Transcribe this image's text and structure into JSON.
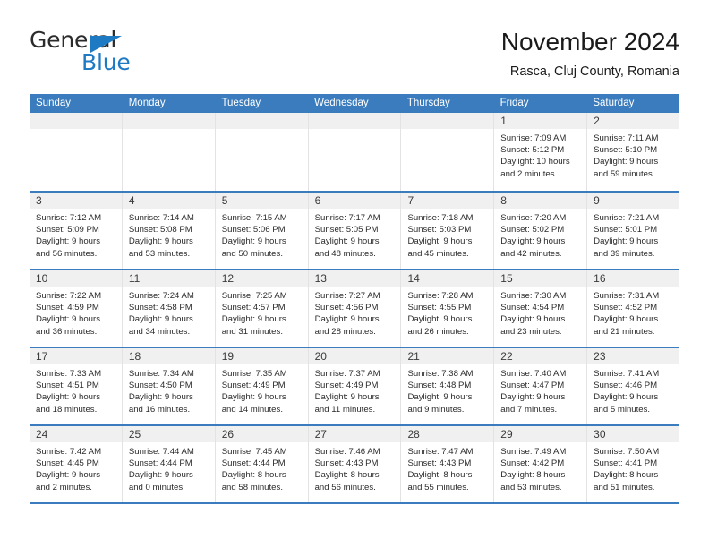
{
  "brand": {
    "name_part1": "General",
    "name_part2": "Blue"
  },
  "header": {
    "title": "November 2024",
    "subtitle": "Rasca, Cluj County, Romania"
  },
  "colors": {
    "header_blue": "#3a7cbd",
    "logo_blue": "#1f7ac4",
    "daynum_band": "#f0f0f0",
    "cell_border": "#e3e3e3"
  },
  "weekdays": [
    "Sunday",
    "Monday",
    "Tuesday",
    "Wednesday",
    "Thursday",
    "Friday",
    "Saturday"
  ],
  "labels": {
    "sunrise_prefix": "Sunrise:",
    "sunset_prefix": "Sunset:",
    "daylight_prefix": "Daylight:"
  },
  "weeks": [
    [
      {
        "day": "",
        "empty": true
      },
      {
        "day": "",
        "empty": true
      },
      {
        "day": "",
        "empty": true
      },
      {
        "day": "",
        "empty": true
      },
      {
        "day": "",
        "empty": true
      },
      {
        "day": "1",
        "sunrise": "Sunrise: 7:09 AM",
        "sunset": "Sunset: 5:12 PM",
        "daylight_line1": "Daylight: 10 hours",
        "daylight_line2": "and 2 minutes."
      },
      {
        "day": "2",
        "sunrise": "Sunrise: 7:11 AM",
        "sunset": "Sunset: 5:10 PM",
        "daylight_line1": "Daylight: 9 hours",
        "daylight_line2": "and 59 minutes."
      }
    ],
    [
      {
        "day": "3",
        "sunrise": "Sunrise: 7:12 AM",
        "sunset": "Sunset: 5:09 PM",
        "daylight_line1": "Daylight: 9 hours",
        "daylight_line2": "and 56 minutes."
      },
      {
        "day": "4",
        "sunrise": "Sunrise: 7:14 AM",
        "sunset": "Sunset: 5:08 PM",
        "daylight_line1": "Daylight: 9 hours",
        "daylight_line2": "and 53 minutes."
      },
      {
        "day": "5",
        "sunrise": "Sunrise: 7:15 AM",
        "sunset": "Sunset: 5:06 PM",
        "daylight_line1": "Daylight: 9 hours",
        "daylight_line2": "and 50 minutes."
      },
      {
        "day": "6",
        "sunrise": "Sunrise: 7:17 AM",
        "sunset": "Sunset: 5:05 PM",
        "daylight_line1": "Daylight: 9 hours",
        "daylight_line2": "and 48 minutes."
      },
      {
        "day": "7",
        "sunrise": "Sunrise: 7:18 AM",
        "sunset": "Sunset: 5:03 PM",
        "daylight_line1": "Daylight: 9 hours",
        "daylight_line2": "and 45 minutes."
      },
      {
        "day": "8",
        "sunrise": "Sunrise: 7:20 AM",
        "sunset": "Sunset: 5:02 PM",
        "daylight_line1": "Daylight: 9 hours",
        "daylight_line2": "and 42 minutes."
      },
      {
        "day": "9",
        "sunrise": "Sunrise: 7:21 AM",
        "sunset": "Sunset: 5:01 PM",
        "daylight_line1": "Daylight: 9 hours",
        "daylight_line2": "and 39 minutes."
      }
    ],
    [
      {
        "day": "10",
        "sunrise": "Sunrise: 7:22 AM",
        "sunset": "Sunset: 4:59 PM",
        "daylight_line1": "Daylight: 9 hours",
        "daylight_line2": "and 36 minutes."
      },
      {
        "day": "11",
        "sunrise": "Sunrise: 7:24 AM",
        "sunset": "Sunset: 4:58 PM",
        "daylight_line1": "Daylight: 9 hours",
        "daylight_line2": "and 34 minutes."
      },
      {
        "day": "12",
        "sunrise": "Sunrise: 7:25 AM",
        "sunset": "Sunset: 4:57 PM",
        "daylight_line1": "Daylight: 9 hours",
        "daylight_line2": "and 31 minutes."
      },
      {
        "day": "13",
        "sunrise": "Sunrise: 7:27 AM",
        "sunset": "Sunset: 4:56 PM",
        "daylight_line1": "Daylight: 9 hours",
        "daylight_line2": "and 28 minutes."
      },
      {
        "day": "14",
        "sunrise": "Sunrise: 7:28 AM",
        "sunset": "Sunset: 4:55 PM",
        "daylight_line1": "Daylight: 9 hours",
        "daylight_line2": "and 26 minutes."
      },
      {
        "day": "15",
        "sunrise": "Sunrise: 7:30 AM",
        "sunset": "Sunset: 4:54 PM",
        "daylight_line1": "Daylight: 9 hours",
        "daylight_line2": "and 23 minutes."
      },
      {
        "day": "16",
        "sunrise": "Sunrise: 7:31 AM",
        "sunset": "Sunset: 4:52 PM",
        "daylight_line1": "Daylight: 9 hours",
        "daylight_line2": "and 21 minutes."
      }
    ],
    [
      {
        "day": "17",
        "sunrise": "Sunrise: 7:33 AM",
        "sunset": "Sunset: 4:51 PM",
        "daylight_line1": "Daylight: 9 hours",
        "daylight_line2": "and 18 minutes."
      },
      {
        "day": "18",
        "sunrise": "Sunrise: 7:34 AM",
        "sunset": "Sunset: 4:50 PM",
        "daylight_line1": "Daylight: 9 hours",
        "daylight_line2": "and 16 minutes."
      },
      {
        "day": "19",
        "sunrise": "Sunrise: 7:35 AM",
        "sunset": "Sunset: 4:49 PM",
        "daylight_line1": "Daylight: 9 hours",
        "daylight_line2": "and 14 minutes."
      },
      {
        "day": "20",
        "sunrise": "Sunrise: 7:37 AM",
        "sunset": "Sunset: 4:49 PM",
        "daylight_line1": "Daylight: 9 hours",
        "daylight_line2": "and 11 minutes."
      },
      {
        "day": "21",
        "sunrise": "Sunrise: 7:38 AM",
        "sunset": "Sunset: 4:48 PM",
        "daylight_line1": "Daylight: 9 hours",
        "daylight_line2": "and 9 minutes."
      },
      {
        "day": "22",
        "sunrise": "Sunrise: 7:40 AM",
        "sunset": "Sunset: 4:47 PM",
        "daylight_line1": "Daylight: 9 hours",
        "daylight_line2": "and 7 minutes."
      },
      {
        "day": "23",
        "sunrise": "Sunrise: 7:41 AM",
        "sunset": "Sunset: 4:46 PM",
        "daylight_line1": "Daylight: 9 hours",
        "daylight_line2": "and 5 minutes."
      }
    ],
    [
      {
        "day": "24",
        "sunrise": "Sunrise: 7:42 AM",
        "sunset": "Sunset: 4:45 PM",
        "daylight_line1": "Daylight: 9 hours",
        "daylight_line2": "and 2 minutes."
      },
      {
        "day": "25",
        "sunrise": "Sunrise: 7:44 AM",
        "sunset": "Sunset: 4:44 PM",
        "daylight_line1": "Daylight: 9 hours",
        "daylight_line2": "and 0 minutes."
      },
      {
        "day": "26",
        "sunrise": "Sunrise: 7:45 AM",
        "sunset": "Sunset: 4:44 PM",
        "daylight_line1": "Daylight: 8 hours",
        "daylight_line2": "and 58 minutes."
      },
      {
        "day": "27",
        "sunrise": "Sunrise: 7:46 AM",
        "sunset": "Sunset: 4:43 PM",
        "daylight_line1": "Daylight: 8 hours",
        "daylight_line2": "and 56 minutes."
      },
      {
        "day": "28",
        "sunrise": "Sunrise: 7:47 AM",
        "sunset": "Sunset: 4:43 PM",
        "daylight_line1": "Daylight: 8 hours",
        "daylight_line2": "and 55 minutes."
      },
      {
        "day": "29",
        "sunrise": "Sunrise: 7:49 AM",
        "sunset": "Sunset: 4:42 PM",
        "daylight_line1": "Daylight: 8 hours",
        "daylight_line2": "and 53 minutes."
      },
      {
        "day": "30",
        "sunrise": "Sunrise: 7:50 AM",
        "sunset": "Sunset: 4:41 PM",
        "daylight_line1": "Daylight: 8 hours",
        "daylight_line2": "and 51 minutes."
      }
    ]
  ]
}
